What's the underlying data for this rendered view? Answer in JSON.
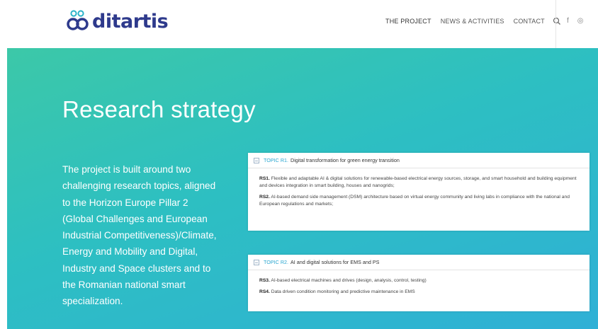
{
  "header": {
    "logo_text": "ditartis",
    "nav": [
      {
        "label": "THE PROJECT"
      },
      {
        "label": "NEWS & ACTIVITIES"
      },
      {
        "label": "CONTACT"
      }
    ],
    "social": [
      "facebook",
      "instagram"
    ]
  },
  "hero": {
    "title": "Research strategy",
    "description": "The project is built around two challenging research topics, aligned to the Horizon Europe Pillar 2 (Global Challenges and European Industrial Competitiveness)/Climate, Energy and Mobility and Digital, Industry and Space clusters and to the Romanian national smart specialization."
  },
  "topics": [
    {
      "code": "TOPIC R1.",
      "title": "Digital transformation for green energy transition",
      "items": [
        {
          "code": "RS1.",
          "text": "Flexible and adaptable AI & digital solutions for renewable-based electrical energy sources, storage, and smart household and building equipment and devices integration in smart building, houses and nanogrids;"
        },
        {
          "code": "RS2.",
          "text": "AI-based demand side management (DSM) architecture based on virtual energy community and living labs in compliance with the national and European regulations and markets;"
        }
      ]
    },
    {
      "code": "TOPIC R2.",
      "title": "AI and digital solutions for EMS and PS",
      "items": [
        {
          "code": "RS3.",
          "text": "AI-based electrical machines and drives (design, analysis, control, testing)"
        },
        {
          "code": "RS4.",
          "text": "Data driven condition monitoring and predictive maintenance in EMS"
        }
      ]
    }
  ],
  "colors": {
    "brand": "#2e3a8c",
    "gradient_start": "#3cc8a8",
    "gradient_end": "#2fb0d6",
    "topic_accent": "#2aa6d0"
  }
}
